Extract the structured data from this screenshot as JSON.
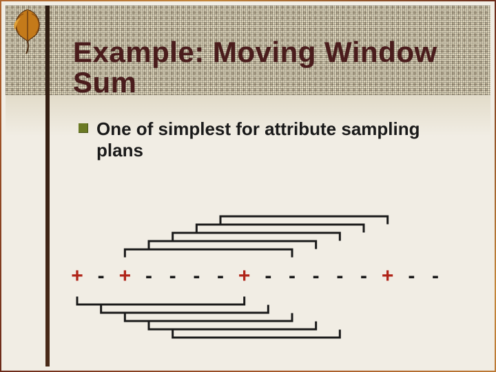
{
  "slide": {
    "title": "Example: Moving Window Sum",
    "bullet_text": "One of simplest for attribute sampling plans",
    "sequence": [
      "+",
      "-",
      "+",
      "-",
      "-",
      "-",
      "-",
      "+",
      "-",
      "-",
      "-",
      "-",
      "-",
      "+",
      "-",
      "-"
    ],
    "colors": {
      "plus": "#b02418",
      "minus": "#1a1a1a",
      "bracket": "#1a1a1a",
      "accent_bullet": "#6b7a24"
    }
  },
  "chart_data": {
    "type": "table",
    "title": "Moving window sum over attribute sequence",
    "sequence": [
      "+",
      "-",
      "+",
      "-",
      "-",
      "-",
      "-",
      "+",
      "-",
      "-",
      "-",
      "-",
      "-",
      "+",
      "-",
      "-"
    ],
    "windows_top": [
      [
        6,
        13
      ],
      [
        5,
        12
      ],
      [
        4,
        11
      ],
      [
        3,
        10
      ],
      [
        2,
        9
      ]
    ],
    "windows_bottom": [
      [
        0,
        7
      ],
      [
        1,
        8
      ],
      [
        2,
        9
      ],
      [
        3,
        10
      ],
      [
        4,
        11
      ]
    ],
    "window_length": 8
  }
}
